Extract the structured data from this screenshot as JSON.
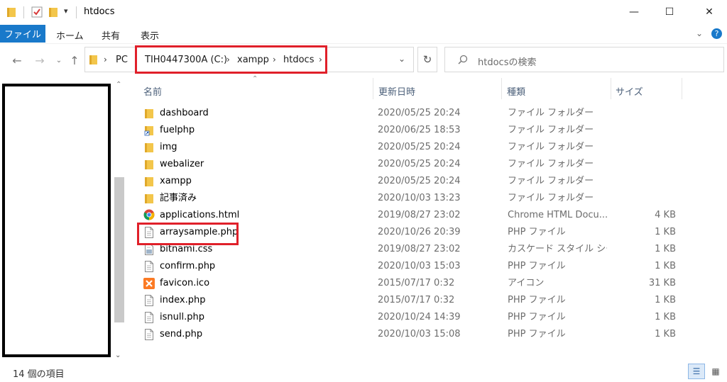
{
  "window": {
    "title": "htdocs",
    "minimize": "—",
    "maximize": "☐",
    "close": "✕"
  },
  "ribbon": {
    "tabs": [
      "ファイル",
      "ホーム",
      "共有",
      "表示"
    ],
    "expand": "⌄",
    "help": "?"
  },
  "address": {
    "segments": [
      "PC",
      "TIH0447300A (C:)",
      "xampp",
      "htdocs"
    ],
    "search_placeholder": "htdocsの検索"
  },
  "columns": {
    "name": "名前",
    "date": "更新日時",
    "type": "種類",
    "size": "サイズ"
  },
  "files": [
    {
      "name": "dashboard",
      "date": "2020/05/25 20:24",
      "type": "ファイル フォルダー",
      "size": "",
      "icon": "folder-icon"
    },
    {
      "name": "fuelphp",
      "date": "2020/06/25 18:53",
      "type": "ファイル フォルダー",
      "size": "",
      "icon": "folder-shortcut-icon"
    },
    {
      "name": "img",
      "date": "2020/05/25 20:24",
      "type": "ファイル フォルダー",
      "size": "",
      "icon": "folder-icon"
    },
    {
      "name": "webalizer",
      "date": "2020/05/25 20:24",
      "type": "ファイル フォルダー",
      "size": "",
      "icon": "folder-icon"
    },
    {
      "name": "xampp",
      "date": "2020/05/25 20:24",
      "type": "ファイル フォルダー",
      "size": "",
      "icon": "folder-icon"
    },
    {
      "name": "記事済み",
      "date": "2020/10/03 13:23",
      "type": "ファイル フォルダー",
      "size": "",
      "icon": "folder-icon"
    },
    {
      "name": "applications.html",
      "date": "2019/08/27 23:02",
      "type": "Chrome HTML Docu...",
      "size": "4 KB",
      "icon": "chrome-icon"
    },
    {
      "name": "arraysample.php",
      "date": "2020/10/26 20:39",
      "type": "PHP ファイル",
      "size": "1 KB",
      "icon": "file-icon"
    },
    {
      "name": "bitnami.css",
      "date": "2019/08/27 23:02",
      "type": "カスケード スタイル シート...",
      "size": "1 KB",
      "icon": "css-file-icon"
    },
    {
      "name": "confirm.php",
      "date": "2020/10/03 15:03",
      "type": "PHP ファイル",
      "size": "1 KB",
      "icon": "file-icon"
    },
    {
      "name": "favicon.ico",
      "date": "2015/07/17 0:32",
      "type": "アイコン",
      "size": "31 KB",
      "icon": "xampp-icon"
    },
    {
      "name": "index.php",
      "date": "2015/07/17 0:32",
      "type": "PHP ファイル",
      "size": "1 KB",
      "icon": "file-icon"
    },
    {
      "name": "isnull.php",
      "date": "2020/10/24 14:39",
      "type": "PHP ファイル",
      "size": "1 KB",
      "icon": "file-icon"
    },
    {
      "name": "send.php",
      "date": "2020/10/03 15:08",
      "type": "PHP ファイル",
      "size": "1 KB",
      "icon": "file-icon"
    }
  ],
  "status": {
    "item_count": "14 個の項目"
  },
  "colors": {
    "accent": "#1979ca",
    "highlight": "#e0202a",
    "folder": "#f3c64b"
  }
}
